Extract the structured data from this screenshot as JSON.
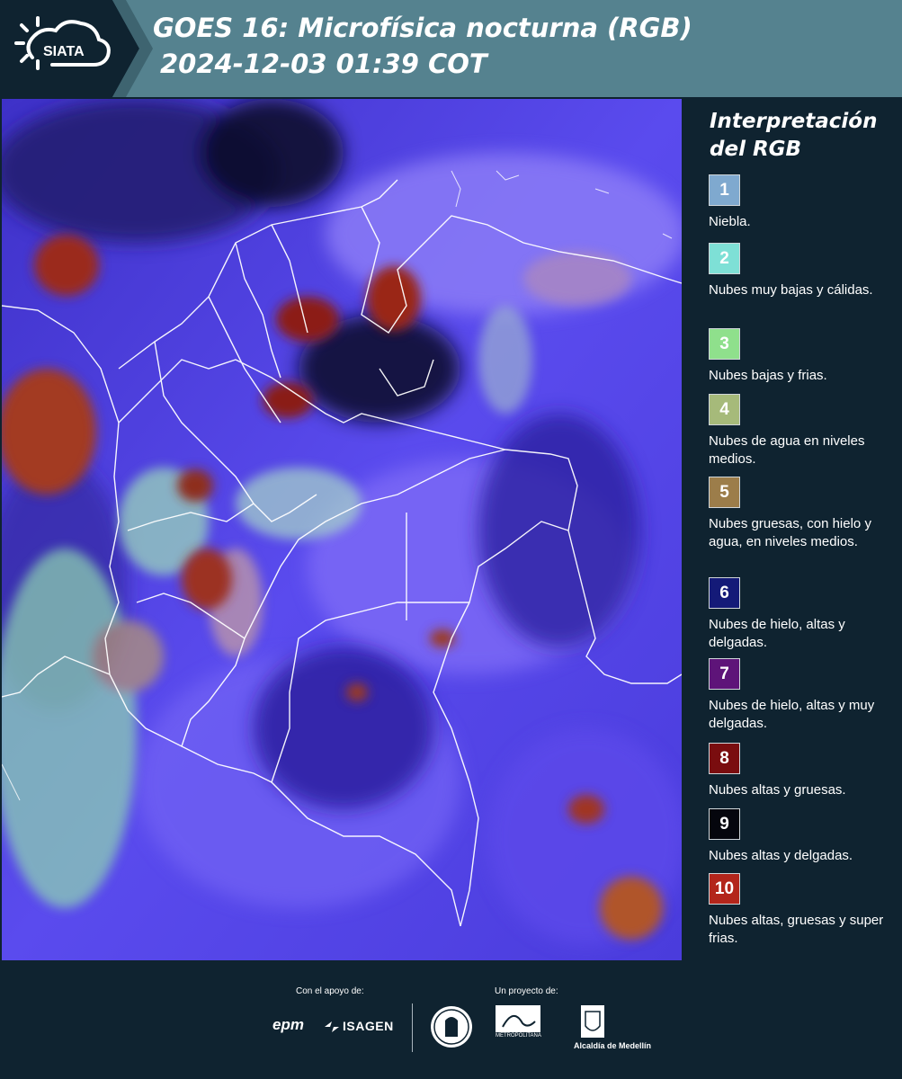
{
  "header": {
    "logo_text": "SIATA",
    "title_line1": "GOES 16: Microfísica nocturna (RGB)",
    "title_line2": "2024-12-03 01:39 COT",
    "colors": {
      "band": "#55828f",
      "band_dark": "#3e6470",
      "background": "#0f2330"
    }
  },
  "map": {
    "description_colors": {
      "base": "#4d3fdf",
      "land": "#6b5cf4"
    }
  },
  "legend": {
    "title": "Interpretación del RGB",
    "items": [
      {
        "number": "1",
        "label": "Niebla.",
        "color": "#7fa9cf"
      },
      {
        "number": "2",
        "label": "Nubes muy bajas y cálidas.",
        "color": "#7ee0d6"
      },
      {
        "number": "3",
        "label": "Nubes bajas y frias.",
        "color": "#8fe08c"
      },
      {
        "number": "4",
        "label": "Nubes de agua en niveles medios.",
        "color": "#a6ba7a"
      },
      {
        "number": "5",
        "label": "Nubes gruesas, con hielo y agua, en niveles medios.",
        "color": "#9c7d4a"
      },
      {
        "number": "6",
        "label": "Nubes de hielo, altas y delgadas.",
        "color": "#141a78"
      },
      {
        "number": "7",
        "label": "Nubes de hielo, altas y muy delgadas.",
        "color": "#5e1479"
      },
      {
        "number": "8",
        "label": "Nubes altas y gruesas.",
        "color": "#7a0d0f"
      },
      {
        "number": "9",
        "label": "Nubes altas y delgadas.",
        "color": "#05060d"
      },
      {
        "number": "10",
        "label": "Nubes altas, gruesas y super frias.",
        "color": "#b3251b"
      }
    ]
  },
  "footer": {
    "support_caption": "Con el apoyo de:",
    "project_caption": "Un proyecto de:",
    "sponsor_epm": "epm",
    "sponsor_isagen": "ISAGEN",
    "sponsor_metro": "METROPOLITANA",
    "sponsor_medellin": "Alcaldía de Medellín"
  }
}
